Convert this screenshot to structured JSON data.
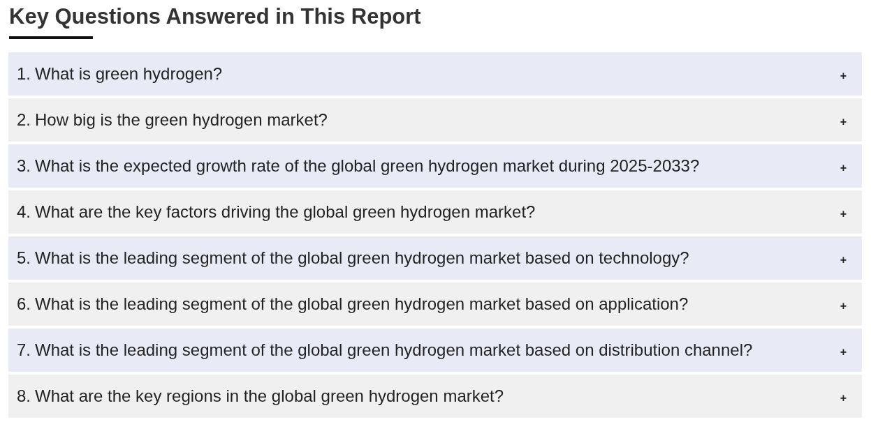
{
  "heading": "Key Questions Answered in This Report",
  "questions": [
    {
      "number": "1.",
      "text": "What is green hydrogen?",
      "toggle": "+"
    },
    {
      "number": "2.",
      "text": "How big is the green hydrogen market?",
      "toggle": "+"
    },
    {
      "number": "3.",
      "text": "What is the expected growth rate of the global green hydrogen market during 2025-2033?",
      "toggle": "+"
    },
    {
      "number": "4.",
      "text": "What are the key factors driving the global green hydrogen market?",
      "toggle": "+"
    },
    {
      "number": "5.",
      "text": "What is the leading segment of the global green hydrogen market based on technology?",
      "toggle": "+"
    },
    {
      "number": "6.",
      "text": "What is the leading segment of the global green hydrogen market based on application?",
      "toggle": "+"
    },
    {
      "number": "7.",
      "text": "What is the leading segment of the global green hydrogen market based on distribution channel?",
      "toggle": "+"
    },
    {
      "number": "8.",
      "text": "What are the key regions in the global green hydrogen market?",
      "toggle": "+"
    }
  ]
}
